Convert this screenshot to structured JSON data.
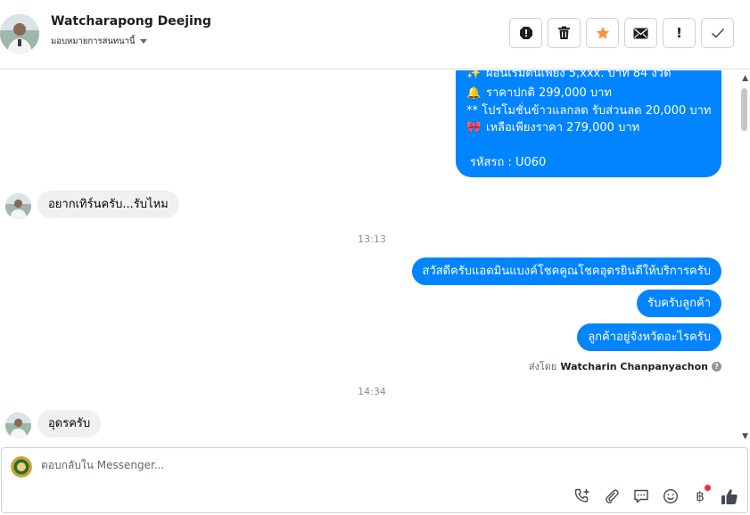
{
  "header": {
    "contact_name": "Watcharapong Deejing",
    "assign_label": "มอบหมายการสนทนานี้"
  },
  "toolbar": {
    "buttons": [
      "spam-icon",
      "trash-icon",
      "star-icon",
      "mail-icon",
      "exclamation-icon",
      "check-icon"
    ],
    "exclamation_label": "!",
    "star_color": "#f7923b"
  },
  "messages": {
    "promo": {
      "line1": "ผ่อนเริ่มต้นเพียง 5,xxx. บาท 84 งวด",
      "line2": "ราคาปกติ 299,000 บาท",
      "line3": "** โปรโมชั่นข้าวแลกลด รับส่วนลด 20,000 บาท",
      "line4": "เหลือเพียงราคา 279,000 บาท",
      "line5": "รหัสรถ : U060",
      "emoji1": "✨",
      "emoji2": "🔔",
      "emoji4": "🎀"
    },
    "in1": "อยากเทิร์นครับ...รับไหม",
    "time1": "13:13",
    "out1": "สวัสดีครับแอดมินแบงค์โชคคูณโชคอุดรยินดีให้บริการครับ",
    "out2": "รับครับลูกค้า",
    "out3": "ลูกค้าอยู่จังหวัดอะไรครับ",
    "sent_by_label": "ส่งโดย",
    "sent_by_name": "Watcharin Chanpanyachon",
    "time2": "14:34",
    "in2": "อุดรครับ"
  },
  "composer": {
    "placeholder": "ตอบกลับใน Messenger...",
    "tools": [
      "phone-plus-icon",
      "attachment-icon",
      "saved-reply-icon",
      "emoji-icon",
      "payment-icon",
      "like-icon"
    ],
    "baht_symbol": "฿"
  },
  "colors": {
    "outgoing_bubble": "#0084ff",
    "incoming_bubble": "#f0f0f0",
    "notification_dot": "#f02849"
  }
}
